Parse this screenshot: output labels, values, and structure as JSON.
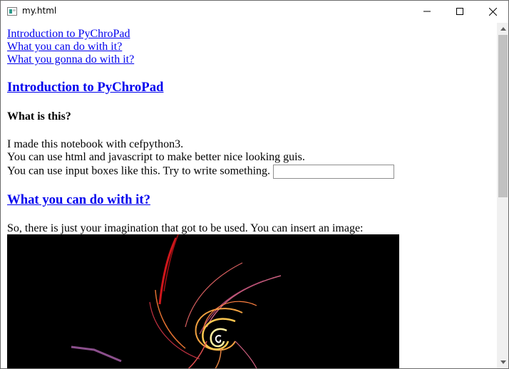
{
  "window": {
    "title": "my.html",
    "controls": {
      "minimize": "minimize-icon",
      "maximize": "maximize-icon",
      "close": "close-icon"
    }
  },
  "nav_links": [
    "Introduction to PyChroPad",
    "What you can do with it?",
    "What you gonna do with it?"
  ],
  "sections": {
    "intro": {
      "heading": "Introduction to PyChroPad",
      "subheading": "What is this?",
      "lines": [
        "I made this notebook with cefpython3.",
        "You can use html and javascript to make better nice looking guis.",
        "You can use input boxes like this. Try to write something."
      ],
      "input_value": "",
      "input_placeholder": ""
    },
    "can_do": {
      "heading": "What you can do with it?",
      "paragraph": "So, there is just your imagination that got to be used. You can insert an image:"
    }
  },
  "colors": {
    "link": "#0000ee",
    "scroll_thumb": "#c1c1c1",
    "image_bg": "#000000"
  }
}
